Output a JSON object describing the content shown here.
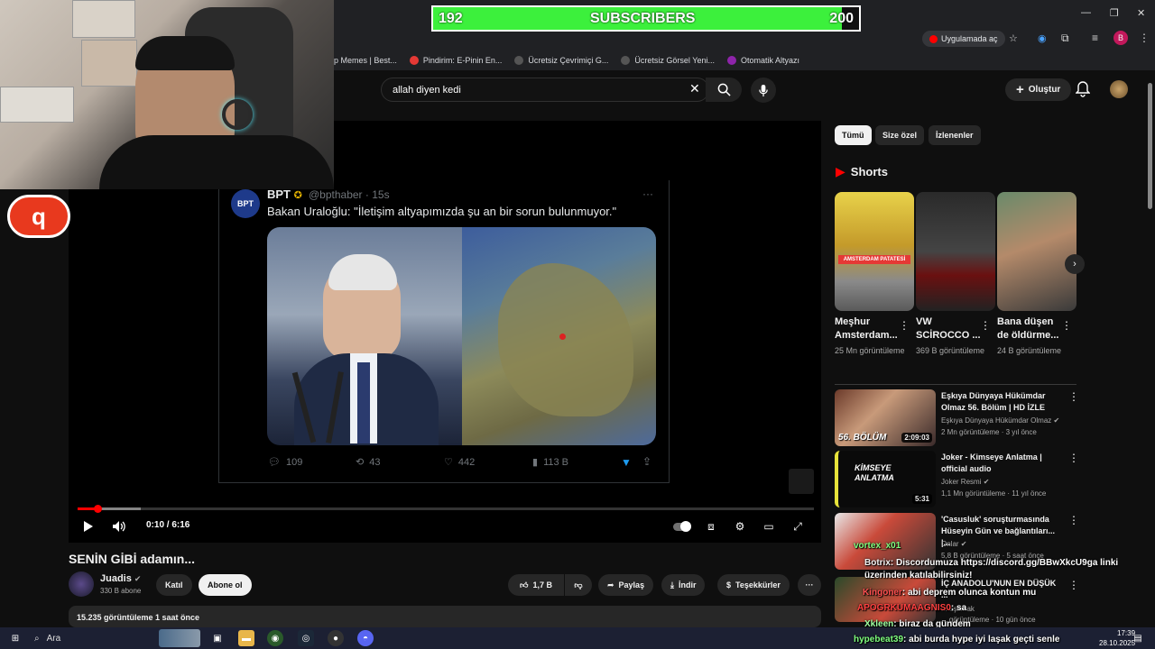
{
  "subscriber_goal": {
    "current": "192",
    "label": "SUBSCRIBERS",
    "target": "200",
    "progress": 0.96
  },
  "browser": {
    "app_open_label": "Uygulamada aç",
    "bookmarks": [
      {
        "label": "p Memes | Best...",
        "color": "#555"
      },
      {
        "label": "Pindirim: E-Pinin En...",
        "color": "#e53935"
      },
      {
        "label": "Ücretsiz Çevrimiçi G...",
        "color": "#333"
      },
      {
        "label": "Ücretsiz Görsel Yeni...",
        "color": "#333"
      },
      {
        "label": "Otomatik Altyazı",
        "color": "#8e24aa"
      }
    ]
  },
  "youtube_header": {
    "search_value": "allah diyen kedi",
    "create_label": "Oluştur"
  },
  "logo_badge": "q",
  "tweet": {
    "name": "BPT",
    "handle": "@bpthaber · 15s",
    "avatar_text": "BPT",
    "text": "Bakan Uraloğlu: \"İletişim altyapımızda şu an bir sorun bulunmuyor.\"",
    "replies": "109",
    "retweets": "43",
    "likes": "442",
    "views": "113 B"
  },
  "player": {
    "time": "0:10 / 6:16",
    "progress": 0.027,
    "buffered": 0.086
  },
  "video": {
    "title": "SENİN GİBİ adamın...",
    "channel": "Juadis",
    "subscribers": "330 B abone",
    "join_label": "Katıl",
    "subscribe_label": "Abone ol",
    "likes_label": "1,7 B",
    "share_label": "Paylaş",
    "download_label": "İndir",
    "thanks_label": "Teşekkürler",
    "more_label": "···",
    "stats": "15.235 görüntüleme  1 saat önce"
  },
  "chips": [
    "Tümü",
    "Size özel",
    "İzlenenler"
  ],
  "shorts": {
    "title": "Shorts",
    "items": [
      {
        "title": "Meşhur Amsterdam...",
        "views": "25 Mn görüntüleme",
        "overlay": "AMSTERDAM PATATESİ"
      },
      {
        "title": "VW SCİROCCO ...",
        "views": "369 B görüntüleme",
        "overlay": ""
      },
      {
        "title": "Bana düşen de öldürme...",
        "views": "24 B görüntüleme",
        "overlay": ""
      }
    ]
  },
  "recommended": [
    {
      "title": "Eşkıya Dünyaya Hükümdar Olmaz 56. Bölüm | HD İZLE",
      "channel": "Eşkıya Dünyaya Hükümdar Olmaz",
      "meta": "2 Mn görüntüleme · 3 yıl önce",
      "duration": "2:09:03",
      "overlay": "56. BÖLÜM"
    },
    {
      "title": "Joker - Kimseye Anlatma | official audio",
      "channel": "Joker Resmi",
      "meta": "1,1 Mn görüntüleme · 11 yıl önce",
      "duration": "5:31",
      "overlay": "KİMSEYE ANLATMA"
    },
    {
      "title": "'Casusluk' soruşturmasında Hüseyin Gün ve bağlantıları... |...",
      "channel": "Onlar",
      "meta": "5,8 B görüntüleme · 5 saat önce",
      "duration": "",
      "overlay": ""
    },
    {
      "title": "İÇ ANADOLU'NUN EN DÜŞÜK ...",
      "channel": "... aşıtmak",
      "meta": "... görüntüleme · 10 gün önce",
      "duration": "",
      "overlay": ""
    }
  ],
  "chat": [
    {
      "user": "vortex_x01",
      "message": "",
      "color": "#7fff7f"
    },
    {
      "user": "Botrix",
      "message": ": Discordumuza https://discord.gg/BBwXkcU9ga linki üzerinden katılabilirsiniz!",
      "color": "#ffffff"
    },
    {
      "user": "Kingoner",
      "message": ": abi deprem olunca kontun mu",
      "color": "#ff5050"
    },
    {
      "user": "APOGRKUMAAGNIS0",
      "message": ": sa",
      "color": "#ff4040"
    },
    {
      "user": "Xkleen",
      "message": ": biraz da gündem",
      "color": "#a0ffa0"
    },
    {
      "user": "hypebeat39",
      "message": ": abi burda hype iyi laşak geçti senle",
      "color": "#7fff7f"
    }
  ],
  "taskbar": {
    "search_placeholder": "Ara",
    "time": "17:39",
    "date": "28.10.2025"
  }
}
